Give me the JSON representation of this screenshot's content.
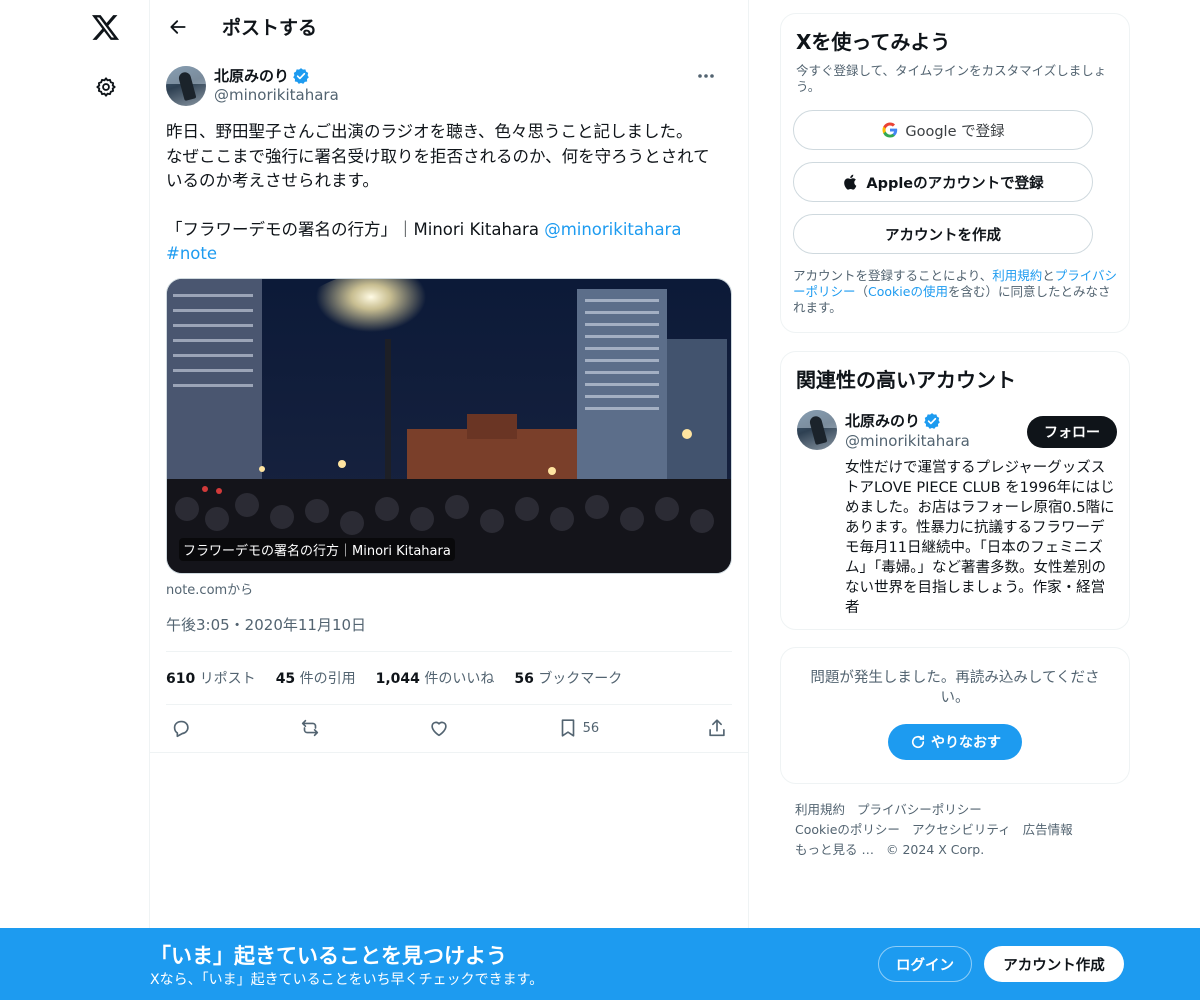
{
  "header": {
    "title": "ポストする"
  },
  "post": {
    "author": {
      "display_name": "北原みのり",
      "handle": "@minorikitahara"
    },
    "text_lines": [
      "昨日、野田聖子さんご出演のラジオを聴き、色々思うこと記しました。",
      "なぜここまで強行に署名受け取りを拒否されるのか、何を守ろうとされて",
      "いるのか考えさせられます。"
    ],
    "text_link_line": {
      "prefix": "「フラワーデモの署名の行方」｜Minori Kitahara ",
      "mention": "@minorikitahara",
      "hashtag": "#note"
    },
    "card": {
      "caption": "フラワーデモの署名の行方｜Minori Kitahara",
      "source": "note.comから"
    },
    "timestamp": "午後3:05・2020年11月10日",
    "stats": [
      {
        "count": "610",
        "label": "リポスト"
      },
      {
        "count": "45",
        "label": "件の引用"
      },
      {
        "count": "1,044",
        "label": "件のいいね"
      },
      {
        "count": "56",
        "label": "ブックマーク"
      }
    ],
    "bookmark_count": "56"
  },
  "signup_box": {
    "title": "Xを使ってみよう",
    "subtitle": "今すぐ登録して、タイムラインをカスタマイズしましょう。",
    "google_label": "Google で登録",
    "apple_label": "Appleのアカウントで登録",
    "create_label": "アカウントを作成",
    "terms": {
      "t1": "アカウントを登録することにより、",
      "link1": "利用規約",
      "t2": "と",
      "link2": "プライバシーポリシー",
      "t3": "（",
      "link3": "Cookieの使用",
      "t4": "を含む）に同意したとみなされます。"
    }
  },
  "related_box": {
    "title": "関連性の高いアカウント",
    "account": {
      "display_name": "北原みのり",
      "handle": "@minorikitahara",
      "follow_label": "フォロー",
      "bio": "女性だけで運営するプレジャーグッズストアLOVE PIECE CLUB を1996年にはじめました。お店はラフォーレ原宿0.5階にあります。性暴力に抗議するフラワーデモ毎月11日継続中。「日本のフェミニズム」「毒婦。」など著書多数。女性差別のない世界を目指しましょう。作家・経営者"
    }
  },
  "error_box": {
    "message": "問題が発生しました。再読み込みしてください。",
    "retry_label": "やりなおす"
  },
  "footer": {
    "links": [
      "利用規約",
      "プライバシーポリシー",
      "Cookieのポリシー",
      "アクセシビリティ",
      "広告情報",
      "もっと見る …"
    ],
    "copyright": "© 2024 X Corp."
  },
  "banner": {
    "title": "「いま」起きていることを見つけよう",
    "subtitle": "Xなら、「いま」起きていることをいち早くチェックできます。",
    "login_label": "ログイン",
    "create_label": "アカウント作成"
  },
  "colors": {
    "accent": "#1d9bf0",
    "text": "#0f1419",
    "secondary": "#536471",
    "border": "#eff3f4"
  }
}
